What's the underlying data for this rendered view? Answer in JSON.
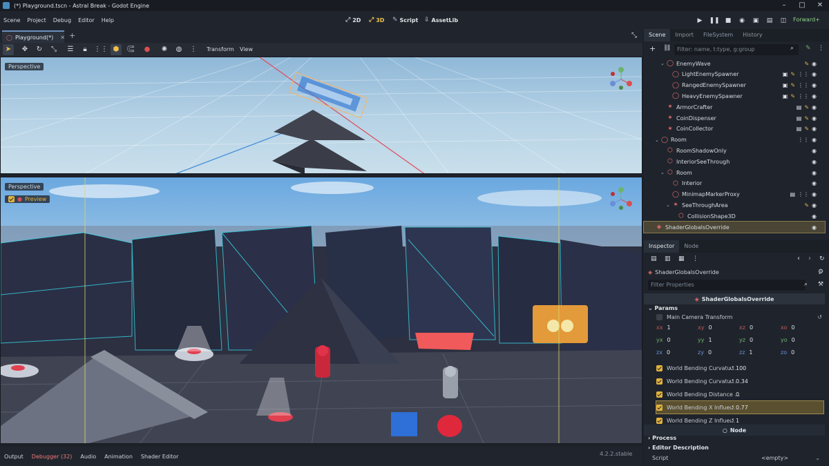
{
  "window": {
    "title": "(*) Playground.tscn - Astral Break - Godot Engine"
  },
  "menu": [
    "Scene",
    "Project",
    "Debug",
    "Editor",
    "Help"
  ],
  "workspaces": [
    {
      "label": "2D",
      "icon": "2d-icon"
    },
    {
      "label": "3D",
      "icon": "3d-icon",
      "active": true
    },
    {
      "label": "Script",
      "icon": "script-icon"
    },
    {
      "label": "AssetLib",
      "icon": "assetlib-icon"
    }
  ],
  "renderer": "Forward+",
  "scene_tab": {
    "label": "Playground(*)"
  },
  "toolbar": {
    "transform": "Transform",
    "view": "View"
  },
  "viewport_top": {
    "label": "Perspective"
  },
  "viewport_bottom": {
    "label": "Perspective",
    "preview": "Preview"
  },
  "bottom_tabs": [
    "Output",
    "Debugger (32)",
    "Audio",
    "Animation",
    "Shader Editor"
  ],
  "version": "4.2.2.stable",
  "scene_dock": {
    "tabs": [
      "Scene",
      "Import",
      "FileSystem",
      "History"
    ],
    "filter_placeholder": "Filter: name, t:type, g:group",
    "tree": [
      {
        "label": "EnemyWave",
        "depth": 3,
        "arrow": "v",
        "icon": "node3d-icon",
        "icons": [
          "script"
        ]
      },
      {
        "label": "LightEnemySpawner",
        "depth": 4,
        "icon": "node3d-icon",
        "icons": [
          "scene",
          "script",
          "group"
        ]
      },
      {
        "label": "RangedEnemySpawner",
        "depth": 4,
        "icon": "node3d-icon",
        "icons": [
          "scene",
          "script",
          "group"
        ]
      },
      {
        "label": "HeavyEnemySpawner",
        "depth": 4,
        "icon": "node3d-icon",
        "icons": [
          "scene",
          "script",
          "group"
        ]
      },
      {
        "label": "ArmorCrafter",
        "depth": 3,
        "icon": "area-icon",
        "icons": [
          "film",
          "script"
        ]
      },
      {
        "label": "CoinDispenser",
        "depth": 3,
        "icon": "area-icon",
        "icons": [
          "film",
          "script"
        ]
      },
      {
        "label": "CoinCollector",
        "depth": 3,
        "icon": "area-icon",
        "icons": [
          "film",
          "script"
        ]
      },
      {
        "label": "Room",
        "depth": 2,
        "arrow": "v",
        "icon": "node3d-icon",
        "icons": [
          "group"
        ]
      },
      {
        "label": "RoomShadowOnly",
        "depth": 3,
        "icon": "mesh-icon",
        "icons": []
      },
      {
        "label": "InteriorSeeThrough",
        "depth": 3,
        "icon": "mesh-icon",
        "icons": []
      },
      {
        "label": "Room",
        "depth": 3,
        "arrow": "v",
        "icon": "mesh-icon",
        "icons": []
      },
      {
        "label": "Interior",
        "depth": 4,
        "icon": "mesh-icon",
        "icons": []
      },
      {
        "label": "MinimapMarkerProxy",
        "depth": 4,
        "icon": "node3d-icon",
        "icons": [
          "film",
          "group"
        ]
      },
      {
        "label": "SeeThroughArea",
        "depth": 4,
        "arrow": "v",
        "icon": "area-icon",
        "icons": [
          "script"
        ]
      },
      {
        "label": "CollisionShape3D",
        "depth": 5,
        "icon": "collision-icon",
        "icons": []
      },
      {
        "label": "ShaderGlobalsOverride",
        "depth": 1,
        "icon": "shader-icon",
        "icons": [],
        "selected": true
      }
    ]
  },
  "inspector": {
    "tabs": [
      "Inspector",
      "Node"
    ],
    "node_name": "ShaderGlobalsOverride",
    "filter_placeholder": "Filter Properties",
    "header": "ShaderGlobalsOverride",
    "section": "Params",
    "camera_transform": {
      "label": "Main Camera Transform",
      "cells": [
        [
          "xx",
          "1"
        ],
        [
          "xy",
          "0"
        ],
        [
          "xz",
          "0"
        ],
        [
          "xo",
          "0"
        ],
        [
          "yx",
          "0"
        ],
        [
          "yy",
          "1"
        ],
        [
          "yz",
          "0"
        ],
        [
          "yo",
          "0"
        ],
        [
          "zx",
          "0"
        ],
        [
          "zy",
          "0"
        ],
        [
          "zz",
          "1"
        ],
        [
          "zo",
          "0"
        ]
      ]
    },
    "params": [
      {
        "label": "World Bending Curvatu...",
        "value": "100",
        "reset": true
      },
      {
        "label": "World Bending Curvatu...",
        "value": "0.34",
        "reset": true
      },
      {
        "label": "World Bending Distance ...",
        "value": "0",
        "reset": false
      },
      {
        "label": "World Bending X Influe...",
        "value": "0.77",
        "reset": true,
        "highlight": true
      },
      {
        "label": "World Bending Z Influe...",
        "value": "1",
        "reset": true
      }
    ],
    "node_footer": "Node",
    "sections_bottom": [
      "Process",
      "Editor Description"
    ],
    "script": {
      "label": "Script",
      "value": "<empty>"
    }
  },
  "colors": {
    "accent": "#f0c04a",
    "error_tab": "#f07b7b",
    "node_icon": "#e86f6f"
  }
}
